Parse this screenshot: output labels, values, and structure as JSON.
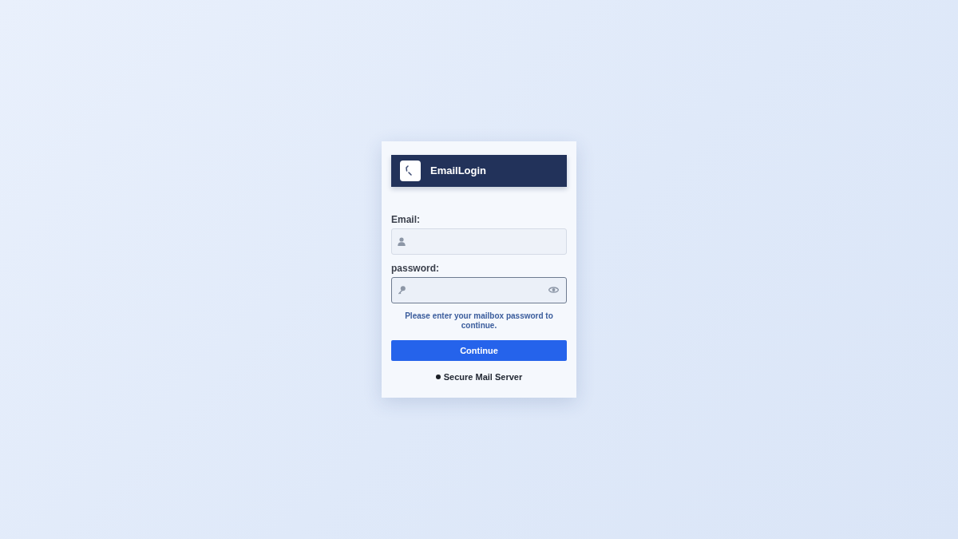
{
  "header": {
    "title": "EmailLogin"
  },
  "form": {
    "fields": [
      {
        "kind": "email",
        "label": "Email:",
        "focused": false
      },
      {
        "kind": "password",
        "label": "password:",
        "focused": true
      }
    ],
    "hint": "Please enter your mailbox password to continue.",
    "submit": "Continue"
  },
  "footer": {
    "text": "Secure Mail Server"
  }
}
